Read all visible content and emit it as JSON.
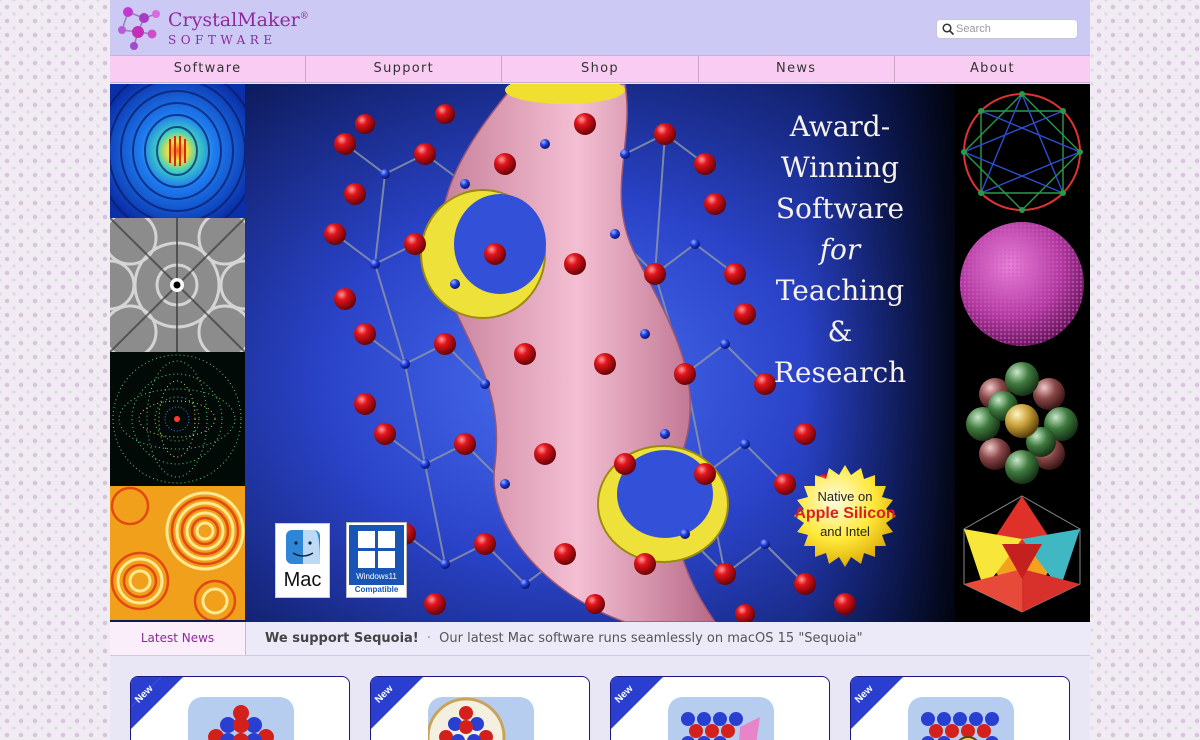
{
  "brand": {
    "name": "CrystalMaker",
    "reg": "®",
    "tagline": "SOFTWARE"
  },
  "search": {
    "placeholder": "Search"
  },
  "nav": [
    {
      "label": "Software"
    },
    {
      "label": "Support"
    },
    {
      "label": "Shop"
    },
    {
      "label": "News"
    },
    {
      "label": "About"
    }
  ],
  "hero": {
    "headline": [
      "Award-",
      "Winning",
      "Software",
      "for",
      "Teaching",
      "&",
      "Research"
    ],
    "silicon_badge": {
      "line1": "Native on",
      "line2": "Apple Silicon",
      "line3": "and Intel"
    },
    "mac_badge": {
      "label": "Mac"
    },
    "windows_badge": {
      "label": "Windows11",
      "sub": "Compatible"
    }
  },
  "ticker": {
    "label": "Latest News",
    "headline": "We support Sequoia!",
    "separator": "·",
    "text": "Our latest Mac software runs seamlessly on macOS 15 \"Sequoia\""
  },
  "cards": [
    {
      "ribbon": "New"
    },
    {
      "ribbon": "New"
    },
    {
      "ribbon": "New"
    },
    {
      "ribbon": "New"
    }
  ],
  "colors": {
    "brand": "#8f2a9c",
    "header_bg": "#cdc9f5",
    "nav_bg": "#f9cdf3",
    "card_border": "#1c1a7c",
    "ribbon": "#2a3fcf"
  }
}
